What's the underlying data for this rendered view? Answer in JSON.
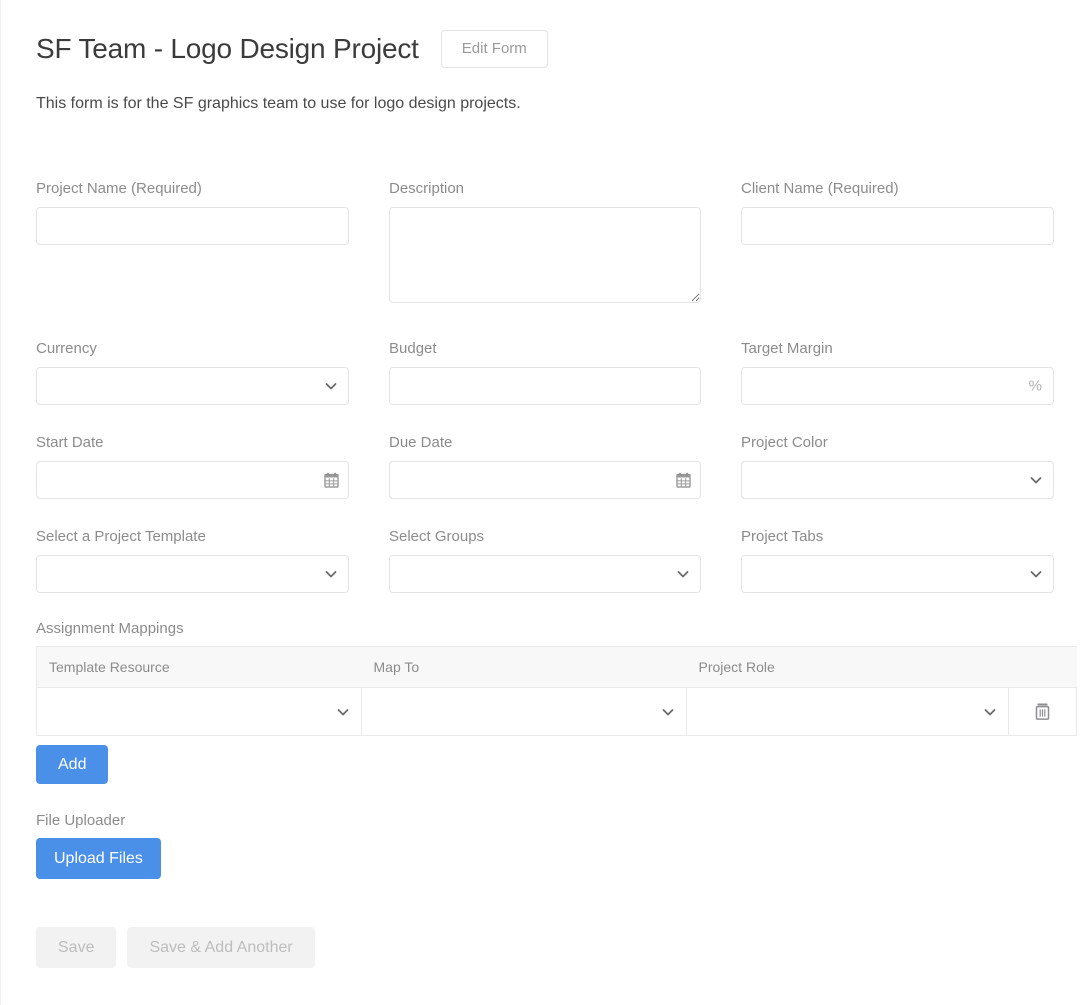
{
  "header": {
    "title": "SF Team - Logo Design Project",
    "edit_form_label": "Edit Form",
    "subtitle": "This form is for the SF graphics team to use for logo design projects."
  },
  "fields": {
    "project_name": {
      "label": "Project Name (Required)",
      "value": "",
      "placeholder": ""
    },
    "description": {
      "label": "Description",
      "value": "",
      "placeholder": ""
    },
    "client_name": {
      "label": "Client Name (Required)",
      "value": "",
      "placeholder": ""
    },
    "currency": {
      "label": "Currency",
      "value": ""
    },
    "budget": {
      "label": "Budget",
      "value": "",
      "placeholder": ""
    },
    "target_margin": {
      "label": "Target Margin",
      "value": "",
      "placeholder": "",
      "suffix": "%"
    },
    "start_date": {
      "label": "Start Date",
      "value": "",
      "placeholder": ""
    },
    "due_date": {
      "label": "Due Date",
      "value": "",
      "placeholder": ""
    },
    "project_color": {
      "label": "Project Color",
      "value": ""
    },
    "project_template": {
      "label": "Select a Project Template",
      "value": ""
    },
    "groups": {
      "label": "Select Groups",
      "value": ""
    },
    "project_tabs": {
      "label": "Project Tabs",
      "value": ""
    }
  },
  "assignment_mappings": {
    "label": "Assignment Mappings",
    "columns": [
      "Template Resource",
      "Map To",
      "Project Role"
    ],
    "rows": [
      {
        "template_resource": "",
        "map_to": "",
        "project_role": ""
      }
    ],
    "add_label": "Add"
  },
  "file_uploader": {
    "label": "File Uploader",
    "button_label": "Upload Files"
  },
  "footer": {
    "save_label": "Save",
    "save_add_another_label": "Save & Add Another"
  },
  "icons": {
    "chevron_down": "chevron-down-icon",
    "calendar": "calendar-icon",
    "trash": "trash-icon"
  },
  "colors": {
    "primary": "#4a90e8",
    "label": "#8c8c8c",
    "border": "#e4e4e4",
    "disabled_bg": "#f2f2f2",
    "disabled_text": "#bdbdbd"
  }
}
